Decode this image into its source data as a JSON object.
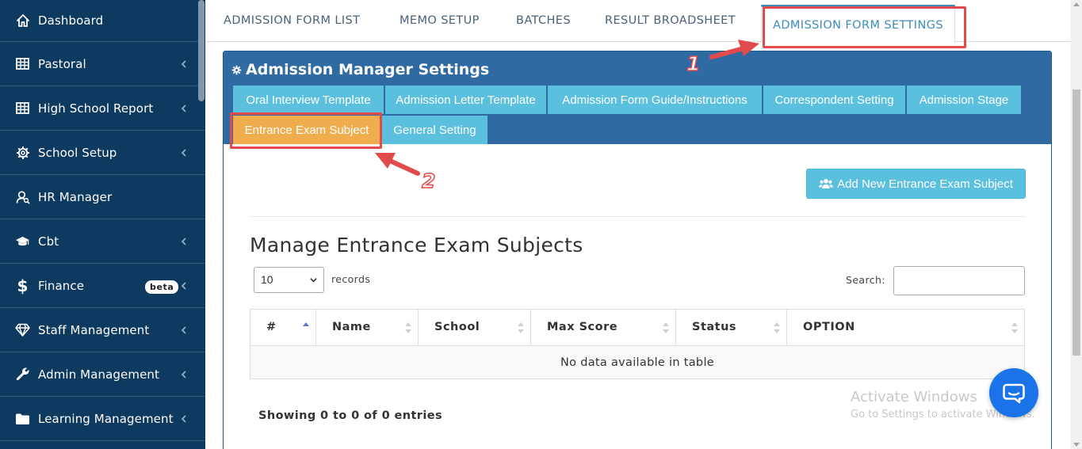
{
  "sidebar": {
    "items": [
      {
        "label": "Dashboard",
        "icon": "home-icon",
        "chevron": false
      },
      {
        "label": "Pastoral",
        "icon": "table-icon",
        "chevron": true
      },
      {
        "label": "High School Report",
        "icon": "table-icon",
        "chevron": true
      },
      {
        "label": "School Setup",
        "icon": "gear-icon",
        "chevron": true
      },
      {
        "label": "HR Manager",
        "icon": "user-search-icon",
        "chevron": false
      },
      {
        "label": "Cbt",
        "icon": "graduation-cap-icon",
        "chevron": true
      },
      {
        "label": "Finance",
        "icon": "dollar-icon",
        "chevron": true,
        "badge": "beta"
      },
      {
        "label": "Staff Management",
        "icon": "diamond-icon",
        "chevron": true
      },
      {
        "label": "Admin Management",
        "icon": "wrench-icon",
        "chevron": true
      },
      {
        "label": "Learning Management",
        "icon": "folder-icon",
        "chevron": true
      }
    ]
  },
  "top_tabs": [
    {
      "label": "ADMISSION FORM LIST"
    },
    {
      "label": "MEMO SETUP"
    },
    {
      "label": "BATCHES"
    },
    {
      "label": "RESULT BROADSHEET"
    },
    {
      "label": "ADMISSION FORM SETTINGS",
      "active": true
    }
  ],
  "panel": {
    "title": "Admission Manager Settings",
    "sub_tabs": [
      {
        "label": "Oral Interview Template"
      },
      {
        "label": "Admission Letter Template"
      },
      {
        "label": "Admission Form Guide/Instructions"
      },
      {
        "label": "Correspondent Setting"
      },
      {
        "label": "Admission Stage"
      },
      {
        "label": "Entrance Exam Subject",
        "active": true
      },
      {
        "label": "General Setting"
      }
    ],
    "add_button": "Add New Entrance Exam Subject",
    "section_title": "Manage Entrance Exam Subjects",
    "length_select": {
      "value": "10",
      "label": "records"
    },
    "search": {
      "label": "Search:",
      "value": ""
    },
    "table": {
      "columns": [
        "#",
        "Name",
        "School",
        "Max Score",
        "Status",
        "OPTION"
      ],
      "empty_message": "No data available in table"
    },
    "info": "Showing 0 to 0 of 0 entries"
  },
  "annotations": {
    "step1": "1",
    "step2": "2",
    "color": "#e24b4b"
  },
  "watermark": {
    "title": "Activate Windows",
    "subtitle": "Go to Settings to activate Windows."
  },
  "colors": {
    "sidebar_bg": "#0f3a5f",
    "panel_head": "#2f6aa3",
    "info_tab": "#5bc0de",
    "active_tab": "#f0ad4e",
    "link_blue": "#3c8dbc",
    "chat_blue": "#1a73e8"
  }
}
